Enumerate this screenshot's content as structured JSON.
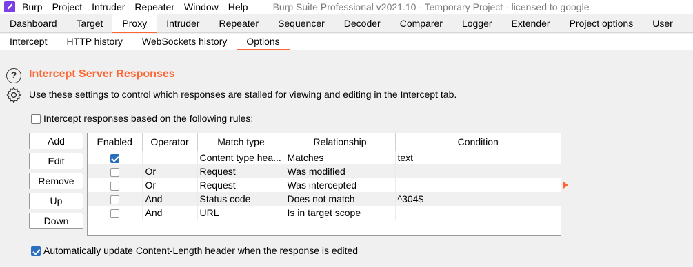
{
  "menubar": {
    "items": [
      "Burp",
      "Project",
      "Intruder",
      "Repeater",
      "Window",
      "Help"
    ],
    "window_title": "Burp Suite Professional v2021.10 - Temporary Project - licensed to google"
  },
  "tabs": [
    "Dashboard",
    "Target",
    "Proxy",
    "Intruder",
    "Repeater",
    "Sequencer",
    "Decoder",
    "Comparer",
    "Logger",
    "Extender",
    "Project options",
    "User"
  ],
  "active_tab": "Proxy",
  "subtabs": [
    "Intercept",
    "HTTP history",
    "WebSockets history",
    "Options"
  ],
  "active_subtab": "Options",
  "section": {
    "title": "Intercept Server Responses",
    "description": "Use these settings to control which responses are stalled for viewing and editing in the Intercept tab.",
    "intercept_label": "Intercept responses based on the following rules:",
    "intercept_checked": false,
    "auto_update_label": "Automatically update Content-Length header when the response is edited",
    "auto_update_checked": true
  },
  "buttons": {
    "add": "Add",
    "edit": "Edit",
    "remove": "Remove",
    "up": "Up",
    "down": "Down"
  },
  "table": {
    "headers": [
      "Enabled",
      "Operator",
      "Match type",
      "Relationship",
      "Condition"
    ],
    "rows": [
      {
        "enabled": true,
        "operator": "",
        "match_type": "Content type hea...",
        "relationship": "Matches",
        "condition": "text"
      },
      {
        "enabled": false,
        "operator": "Or",
        "match_type": "Request",
        "relationship": "Was modified",
        "condition": ""
      },
      {
        "enabled": false,
        "operator": "Or",
        "match_type": "Request",
        "relationship": "Was intercepted",
        "condition": ""
      },
      {
        "enabled": false,
        "operator": "And",
        "match_type": "Status code",
        "relationship": "Does not match",
        "condition": "^304$"
      },
      {
        "enabled": false,
        "operator": "And",
        "match_type": "URL",
        "relationship": "Is in target scope",
        "condition": ""
      }
    ]
  },
  "colors": {
    "accent": "#ff6633",
    "checkbox_checked": "#2a6fbd"
  },
  "icons": {
    "help": "question-circle-icon",
    "settings": "gear-icon"
  },
  "help_glyph": "?"
}
